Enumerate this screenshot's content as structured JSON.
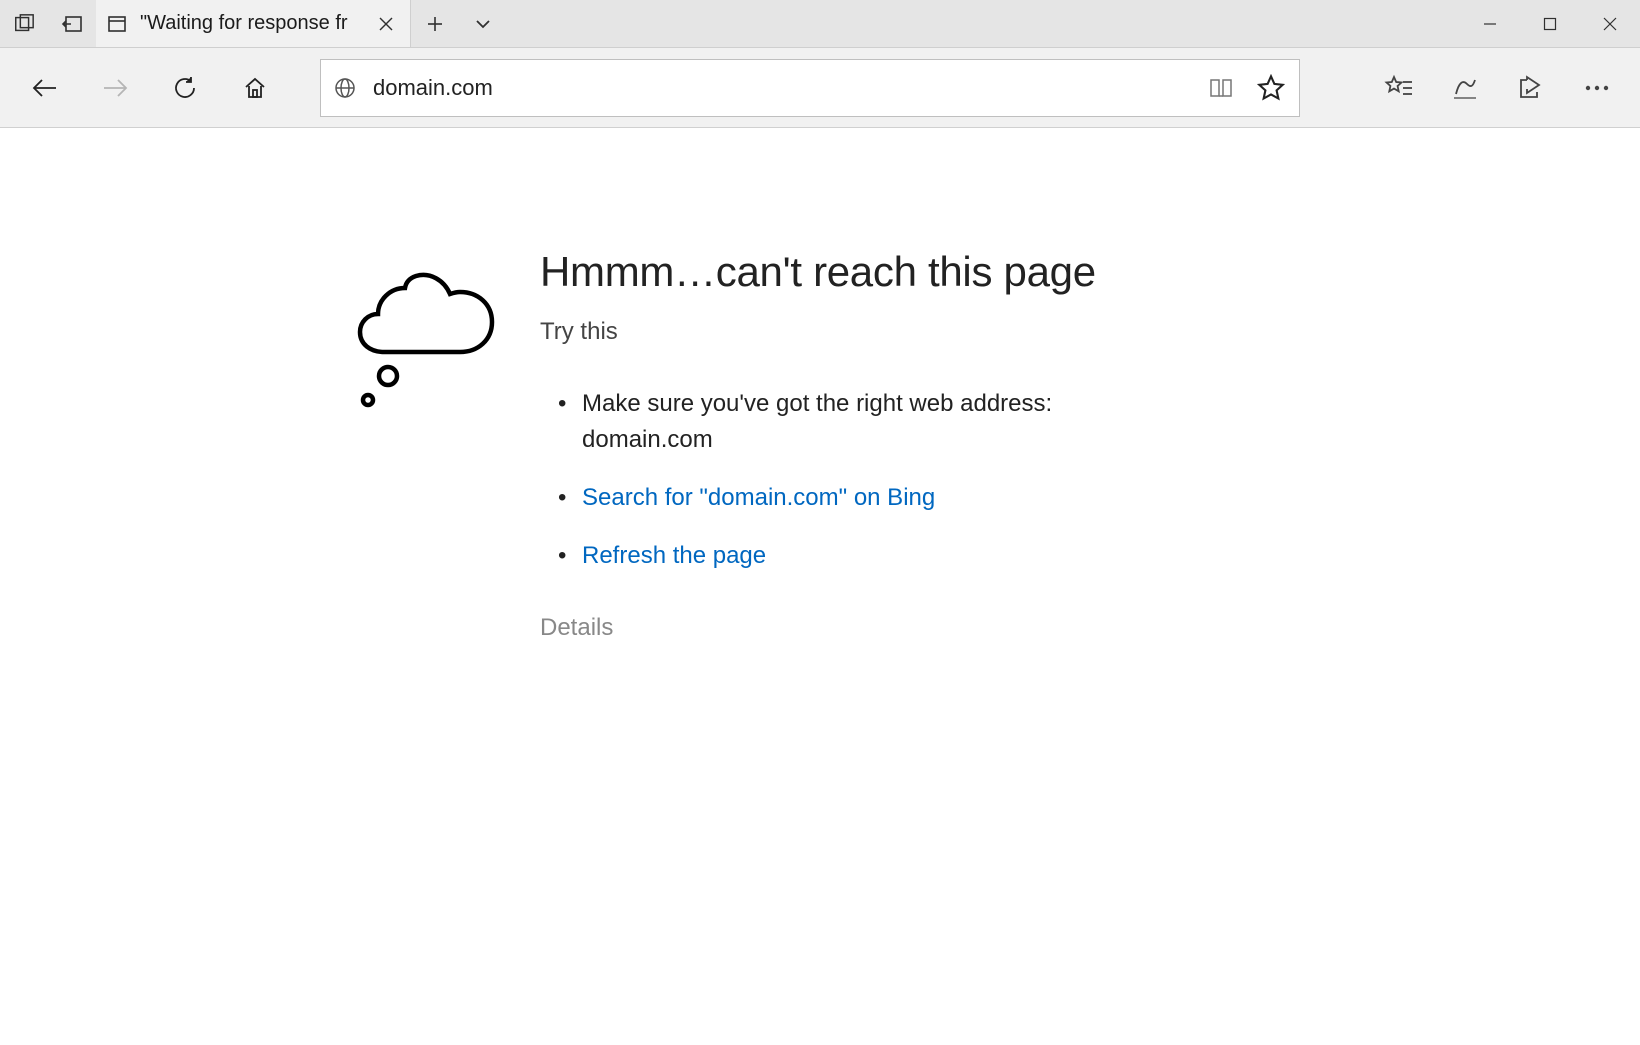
{
  "tab": {
    "title": "\"Waiting for response fr"
  },
  "address": {
    "value": "domain.com"
  },
  "error": {
    "title": "Hmmm…can't reach this page",
    "try_this": "Try this",
    "suggestion_text": "Make sure you've got the right web address: domain.com",
    "search_link": "Search for \"domain.com\" on Bing",
    "refresh_link": "Refresh the page",
    "details": "Details"
  }
}
